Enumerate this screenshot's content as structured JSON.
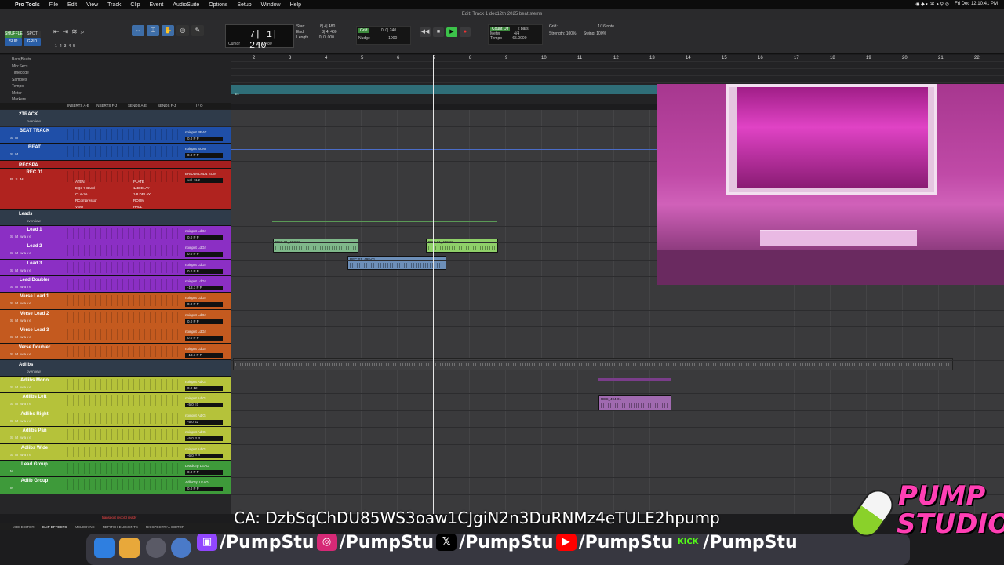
{
  "menubar": {
    "app": "Pro Tools",
    "items": [
      "File",
      "Edit",
      "View",
      "Track",
      "Clip",
      "Event",
      "AudioSuite",
      "Options",
      "Setup",
      "Window",
      "Help"
    ],
    "datetime": "Fri Dec 12  10:41 PM"
  },
  "window_title": "Edit: Track 1 dec12th 2025 beat stems",
  "transport": {
    "modes": [
      "SHUFFLE",
      "SPOT",
      "SLIP",
      "GRID"
    ],
    "counter": "7| 1| 240",
    "cursor": "Cursor",
    "cursor_value": "8| 4| 480",
    "start_label": "Start",
    "start": "8| 4| 480",
    "end_label": "End",
    "end": "8| 4| 480",
    "length_label": "Length",
    "length": "0| 0| 000",
    "grid_label": "Grid",
    "grid_value": "0| 0| 240",
    "nudge_label": "Nudge",
    "nudge_value": "1000",
    "count_off": "Count Off",
    "meter": "Meter",
    "meter_value": "4/4",
    "tempo": "Tempo",
    "tempo_value": "65.0000",
    "bars": "2 bars",
    "grid_note": "1/16 note",
    "strength": "Strength:",
    "strength_value": "100%",
    "swing": "Swing:",
    "swing_value": "100%",
    "track_nums": [
      "1",
      "2",
      "3",
      "4",
      "5"
    ]
  },
  "rulers": {
    "labels": [
      "Bars|Beats",
      "Min:Secs",
      "Timecode",
      "Samples",
      "Tempo",
      "Meter",
      "Markers"
    ],
    "bars": [
      "2",
      "3",
      "4",
      "5",
      "6",
      "7",
      "8",
      "9",
      "10",
      "11",
      "12",
      "13",
      "14",
      "15",
      "16",
      "17",
      "18",
      "19",
      "20",
      "21",
      "22"
    ],
    "tempo_marker": "4/4"
  },
  "column_headers": [
    "INSERTS A-E",
    "INSERTS F-J",
    "SENDS A-E",
    "SENDS F-J",
    "I / O"
  ],
  "tracks": [
    {
      "type": "folder",
      "name": "2TRACK",
      "sub": "overview",
      "color": "#2f3b4a"
    },
    {
      "type": "track",
      "name": "BEAT TRACK",
      "btns": "S M",
      "io": "noinput BEAT",
      "vol": "0.0  P P",
      "color": "#1f4fa8"
    },
    {
      "type": "track",
      "name": "BEAT",
      "btns": "S M",
      "io": "noinput SUM",
      "vol": "0.0  P P",
      "color": "#1f4fa8"
    },
    {
      "type": "folder",
      "name": "RECSPA",
      "sub": "",
      "color": "#a51f1f"
    },
    {
      "type": "track",
      "name": "REC.01",
      "btns": "R S M",
      "io": "BRIDLMLHD1 SUM",
      "vol": "vol +4.2",
      "color": "#b0231f"
    },
    {
      "type": "folder",
      "name": "Leads",
      "sub": "overview",
      "color": "#2f3b4a"
    },
    {
      "type": "track",
      "name": "Lead 1",
      "btns": "S M wave",
      "io": "noinput LdGr",
      "vol": "0.0  P P",
      "color": "#8b2fc4"
    },
    {
      "type": "track",
      "name": "Lead 2",
      "btns": "S M wave",
      "io": "noinput LdGr",
      "vol": "0.0  P P",
      "color": "#8b2fc4"
    },
    {
      "type": "track",
      "name": "Lead 3",
      "btns": "S M wave",
      "io": "noinput LdGr",
      "vol": "0.0  P P",
      "color": "#8b2fc4"
    },
    {
      "type": "track",
      "name": "Lead Doubler",
      "btns": "S M wave",
      "io": "noinput LdGr",
      "vol": "-13.1  P P",
      "color": "#8b2fc4"
    },
    {
      "type": "track",
      "name": "Verse Lead 1",
      "btns": "S M wave",
      "io": "noinput LdGr",
      "vol": "0.0  P P",
      "color": "#c45a1f"
    },
    {
      "type": "track",
      "name": "Verse Lead 2",
      "btns": "S M wave",
      "io": "noinput LdGr",
      "vol": "0.0  P P",
      "color": "#c45a1f"
    },
    {
      "type": "track",
      "name": "Verse Lead 3",
      "btns": "S M wave",
      "io": "noinput LdGr",
      "vol": "0.0  P P",
      "color": "#c45a1f"
    },
    {
      "type": "track",
      "name": "Verse Doubler",
      "btns": "S M wave",
      "io": "noinput LdGr",
      "vol": "-13.1  P P",
      "color": "#c45a1f"
    },
    {
      "type": "folder",
      "name": "Adlibs",
      "sub": "overview",
      "color": "#2f3b4a"
    },
    {
      "type": "track",
      "name": "Adlibs Mono",
      "btns": "S M wave",
      "io": "noinput AdlG",
      "vol": "0.0  12",
      "color": "#b5c23a"
    },
    {
      "type": "track",
      "name": "Adlibs Left",
      "btns": "S M wave",
      "io": "noinput AdlG",
      "vol": "-5.0  <0",
      "color": "#b5c23a"
    },
    {
      "type": "track",
      "name": "Adlibs Right",
      "btns": "S M wave",
      "io": "noinput AdlG",
      "vol": "-5.0  62",
      "color": "#b5c23a"
    },
    {
      "type": "track",
      "name": "Adlibs Pan",
      "btns": "S M wave",
      "io": "noinput AdlG",
      "vol": "-5.0  P P",
      "color": "#b5c23a"
    },
    {
      "type": "track",
      "name": "Adlibs Wide",
      "btns": "S M wave",
      "io": "noinput AdlG",
      "vol": "-6.0  P P",
      "color": "#b5c23a"
    },
    {
      "type": "track",
      "name": "Lead Group",
      "btns": "M",
      "io": "LeadGrp LEAD",
      "vol": "0.0  P P",
      "color": "#3e9a3a"
    },
    {
      "type": "track",
      "name": "Adlib Group",
      "btns": "M",
      "io": "AdlbGrp LEAD",
      "vol": "0.0  P P",
      "color": "#3e9a3a"
    }
  ],
  "recsend_plugins": [
    "ATEN",
    "EQ3 7-Band",
    "CLA-2A",
    "RCompressor",
    "VBW",
    "PLATE",
    "1/4DELAY",
    "1/8 DELAY",
    "ROOM",
    "HALL"
  ],
  "clips": [
    {
      "name": "REC.01_497-01",
      "gain": "0 dB",
      "color": "#8fd069"
    },
    {
      "name": "REC.01_499-01",
      "gain": "0 dB",
      "color": "#8fd069"
    },
    {
      "name": "REC.01_498-01",
      "gain": "0 dB",
      "color": "#6d8fb8"
    },
    {
      "name": "REC_494-01",
      "gain": "0 dB",
      "color": "#a06ab0"
    }
  ],
  "bottom_tabs": [
    "MIDI EDITOR",
    "CLIP EFFECTS",
    "MELODYNE",
    "REPITCH ELEMENTS",
    "RX SPECTRAL EDITOR"
  ],
  "status_text": "transport record ready",
  "overlay": {
    "ca": "CA: DzbSqChDU85WS3oaw1CJgiN2n3DuRNMz4eTULE2hpump",
    "handle": "/PumpStu",
    "logo_top": "PUMP",
    "logo_bottom": "STUDIO",
    "kick": "KICK"
  }
}
